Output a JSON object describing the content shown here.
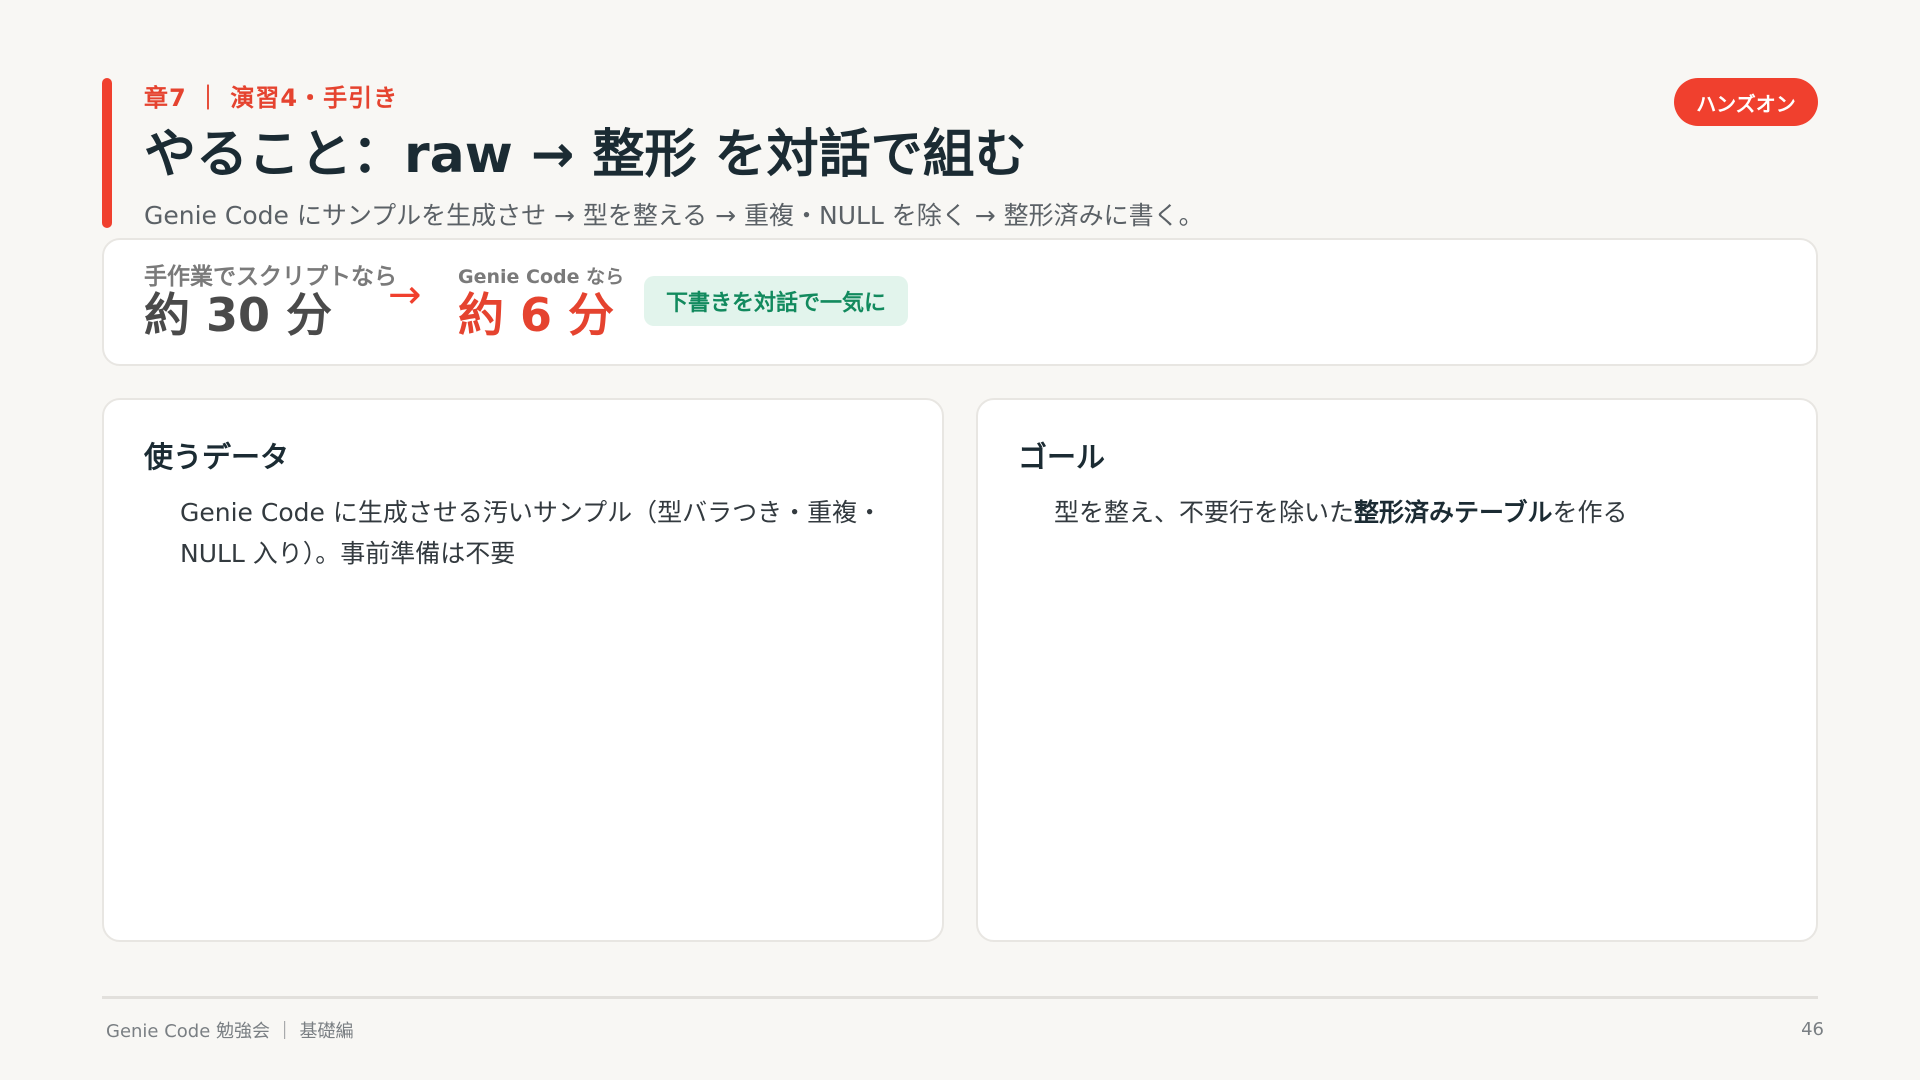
{
  "header": {
    "eyebrow": "章7 ｜ 演習4・手引き",
    "title": "やること：raw → 整形 を対話で組む",
    "subtitle": "Genie Code にサンプルを生成させ → 型を整える → 重複・NULL を除く → 整形済みに書く。",
    "badge": "ハンズオン"
  },
  "time_comparison": {
    "manual_label": "手作業でスクリプトなら",
    "manual_value": "約 30 分",
    "genie_label": "Genie Code なら",
    "genie_value": "約 6 分",
    "tag": "下書きを対話で一気に"
  },
  "cards": {
    "data": {
      "heading": "使うデータ",
      "body": "Genie Code に生成させる汚いサンプル（型バラつき・重複・NULL 入り）。事前準備は不要"
    },
    "goal": {
      "heading": "ゴール",
      "body_before": "型を整え、不要行を除いた",
      "body_bold": "整形済みテーブル",
      "body_after": "を作る"
    }
  },
  "footer": {
    "left": "Genie Code 勉強会 ｜ 基礎編",
    "page_number": "46"
  },
  "colors": {
    "accent": "#F0402E",
    "tag_bg": "#E2F4EC",
    "tag_text": "#128A5E",
    "title": "#1B2B33"
  }
}
